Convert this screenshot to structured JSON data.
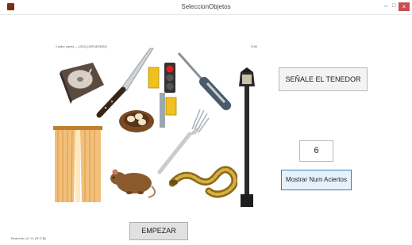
{
  "window": {
    "title": "SeleccionObjetos",
    "close_glyph": "×",
    "minimize_glyph": "–",
    "maximize_glyph": "□"
  },
  "stimulus": {
    "header_left": "1 selbo: parma — (JS13) (JS/PUEDE/E0)",
    "header_right": "FLIM",
    "objects": [
      "record-player",
      "knife",
      "traffic-light",
      "screwdriver",
      "street-lamp",
      "bird-nest",
      "fork",
      "curtain",
      "rat",
      "snake"
    ]
  },
  "instruction_button": "SEÑALE EL TENEDOR",
  "hits_count": "6",
  "show_hits_button": "Mostrar Num Aciertos",
  "start_button": "EMPEZAR",
  "status_bar": "Real info: (X, Y): [R G B]",
  "colors": {
    "close": "#c75050",
    "focus_border": "#3c7fb1",
    "focus_fill": "#e5f1fb"
  }
}
